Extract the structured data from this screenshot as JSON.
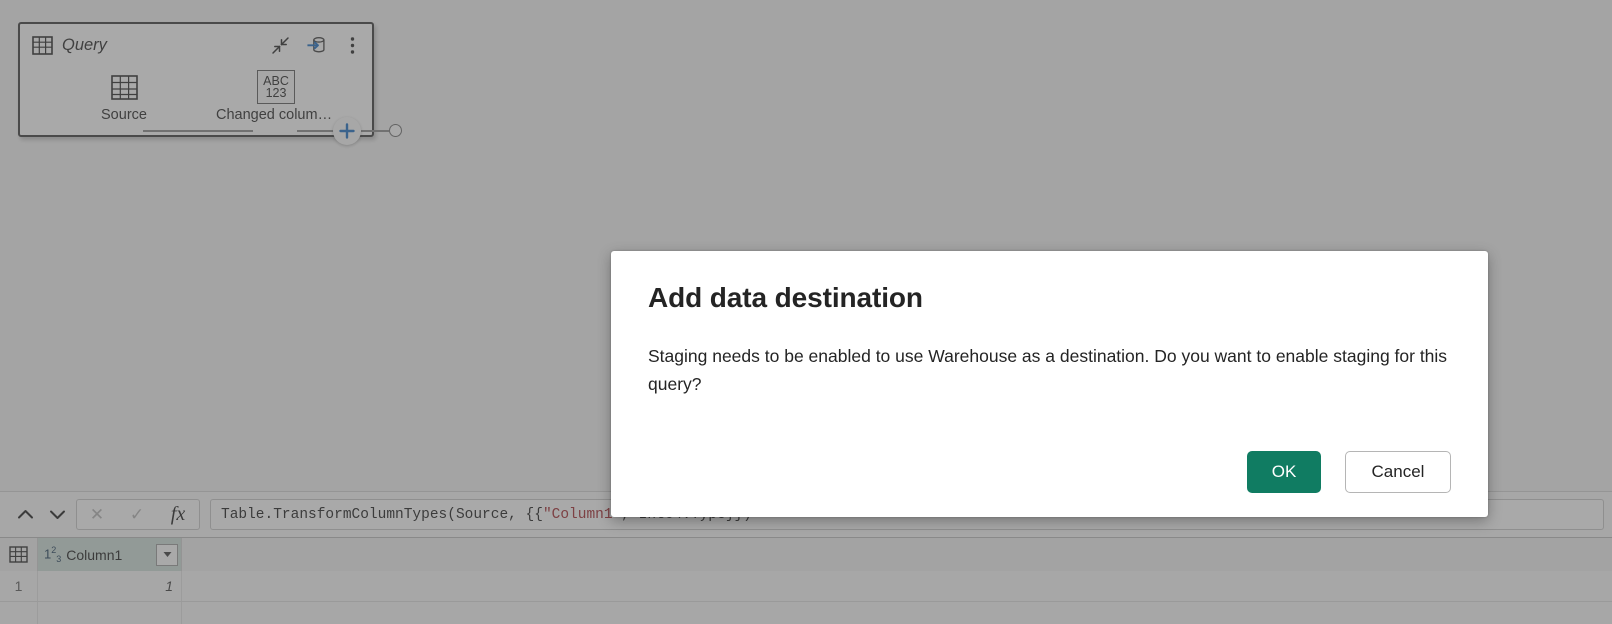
{
  "query_card": {
    "title": "Query",
    "table_icon": "table-icon",
    "actions": [
      {
        "name": "collapse-icon",
        "tooltip": "Collapse"
      },
      {
        "name": "data-destination-icon",
        "tooltip": "Data destination"
      },
      {
        "name": "more-options-icon",
        "tooltip": "More options"
      }
    ],
    "steps": [
      {
        "label": "Source",
        "icon": "table-icon"
      },
      {
        "label": "Changed column...",
        "icon": "abc-123-icon",
        "icon_text_top": "ABC",
        "icon_text_bottom": "123"
      }
    ],
    "add_step": "+",
    "end_node": "end-node"
  },
  "formula_bar": {
    "nav_up": "⌃",
    "nav_down": "⌄",
    "cancel_icon": "✕",
    "accept_icon": "✓",
    "fx_label": "fx",
    "formula_prefix": "Table.TransformColumnTypes(Source, {{",
    "formula_string": "\"Column1\"",
    "formula_suffix": ", Int64.Type}})"
  },
  "data_grid": {
    "corner_icon": "table-icon",
    "columns": [
      {
        "type_glyph_prefix": "1",
        "type_glyph_sup": "2",
        "type_glyph_sub": "3",
        "name": "Column1",
        "filter_icon": "▼"
      }
    ],
    "rows": [
      {
        "index": "1",
        "cells": [
          "1"
        ]
      }
    ]
  },
  "dialog": {
    "title": "Add data destination",
    "body": "Staging needs to be enabled to use Warehouse as a destination. Do you want to enable staging for this query?",
    "ok_label": "OK",
    "cancel_label": "Cancel",
    "ok_color": "#107c62"
  }
}
